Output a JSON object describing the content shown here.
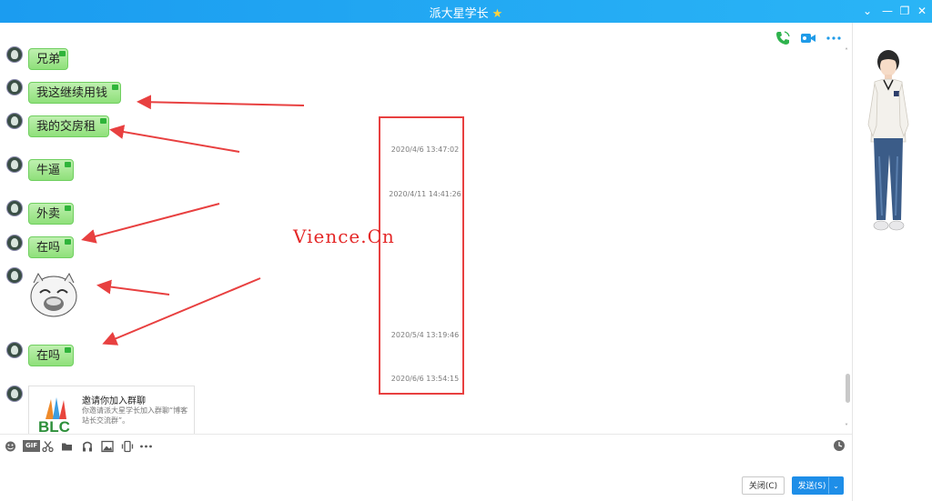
{
  "window": {
    "title": "派大星学长",
    "title_star": "★"
  },
  "header": {
    "icons": [
      "phone-icon",
      "video-icon",
      "more-icon"
    ]
  },
  "messages": [
    {
      "type": "text",
      "text": "兄弟"
    },
    {
      "type": "text",
      "text": "我这继续用钱"
    },
    {
      "type": "text",
      "text": "我的交房租"
    },
    {
      "type": "text",
      "text": "牛逼"
    },
    {
      "type": "text",
      "text": "外卖"
    },
    {
      "type": "text",
      "text": "在吗"
    },
    {
      "type": "sticker",
      "name": "laughing-sticker"
    },
    {
      "type": "text",
      "text": "在吗"
    },
    {
      "type": "card",
      "title": "邀请你加入群聊",
      "desc": "你邀请派大星学长加入群聊“博客站长交流群”。"
    }
  ],
  "timestamps": [
    "2020/4/6 13:47:02",
    "2020/4/11 14:41:26",
    "2020/5/4 13:19:46",
    "2020/6/6 13:54:15"
  ],
  "watermark": "Vience.Cn",
  "card_logo_text": "BLC",
  "toolbar": {
    "icons": [
      "emoji-icon",
      "gif-icon",
      "scissors-icon",
      "folder-icon",
      "music-icon",
      "image-icon",
      "shake-icon",
      "more-icon"
    ],
    "gif_label": "GIF",
    "right_icon": "history-clock-icon"
  },
  "footer": {
    "close_label": "关闭(C)",
    "send_label": "发送(S)",
    "send_dropdown": "⌄"
  },
  "colors": {
    "titlebar": "#2ab5f6",
    "bubble": "#8fe07a",
    "annotation_red": "#e84040",
    "send_button": "#1e8ee8"
  }
}
